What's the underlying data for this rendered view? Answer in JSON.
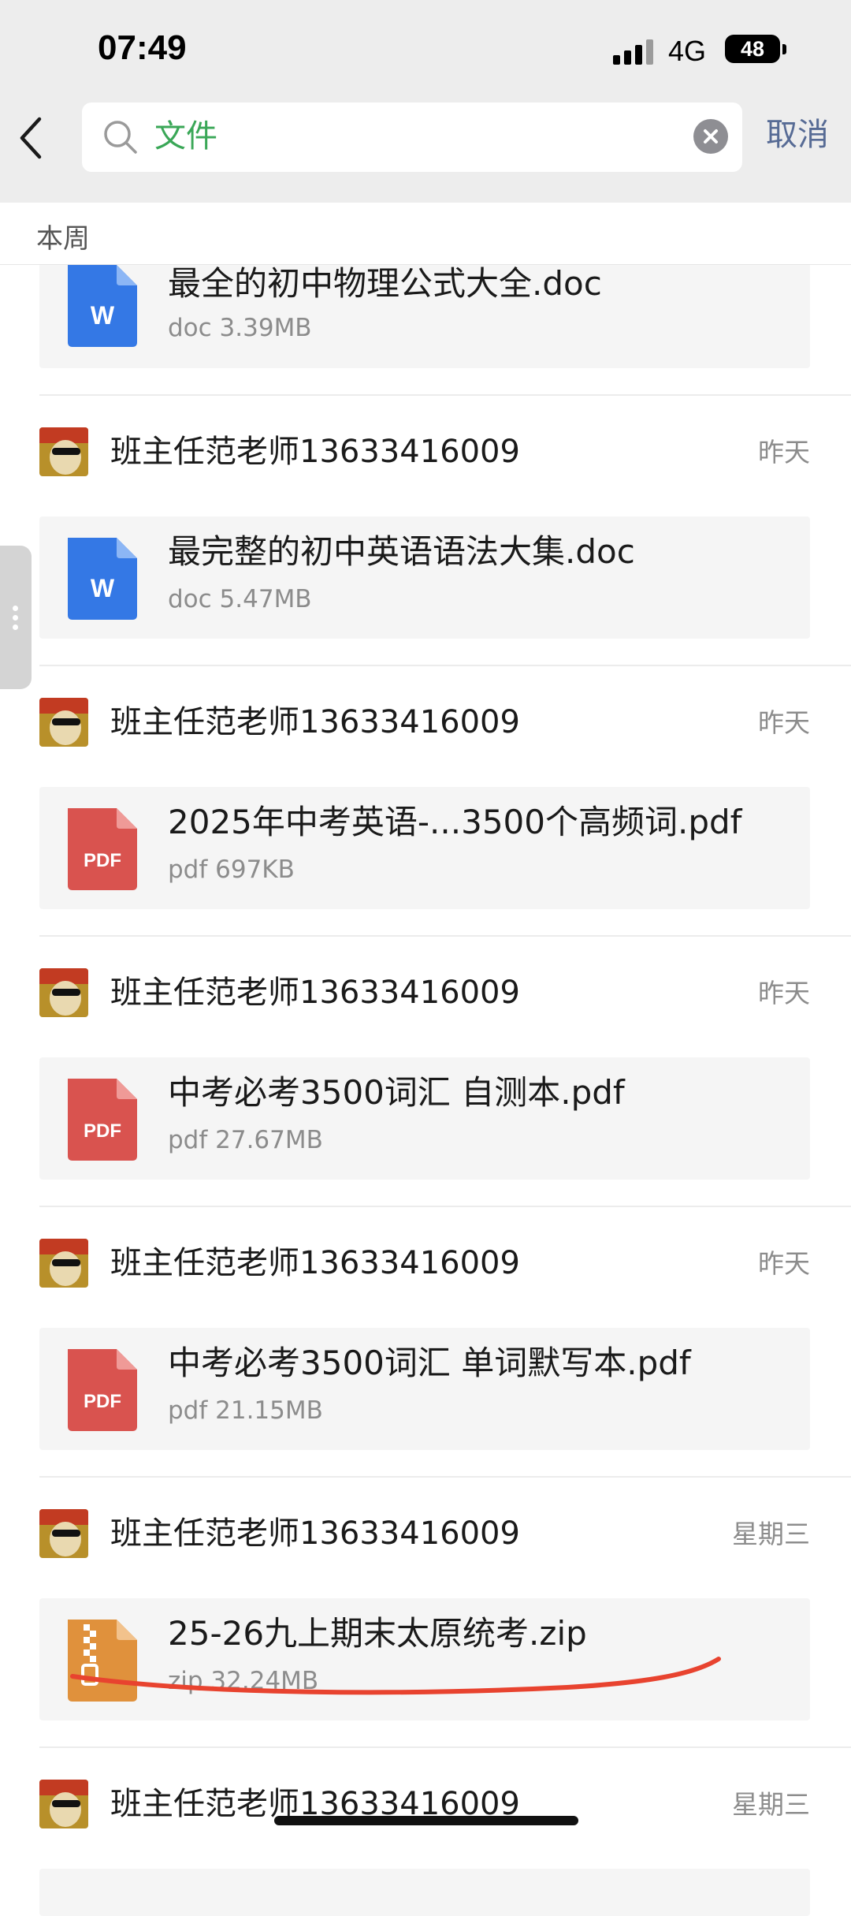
{
  "status_bar": {
    "time": "07:49",
    "network": "4G",
    "battery": "48"
  },
  "search": {
    "query": "文件",
    "cancel_label": "取消"
  },
  "section": {
    "label": "本周"
  },
  "first_file": {
    "name": "最全的初中物理公式大全.doc",
    "meta": "doc 3.39MB",
    "icon": "word-doc-icon"
  },
  "items": [
    {
      "sender": "班主任范老师13633416009",
      "date": "昨天",
      "file_name": "最完整的初中英语语法大集.doc",
      "file_meta": "doc 5.47MB",
      "type": "doc"
    },
    {
      "sender": "班主任范老师13633416009",
      "date": "昨天",
      "file_name": "2025年中考英语-...3500个高频词.pdf",
      "file_meta": "pdf 697KB",
      "type": "pdf"
    },
    {
      "sender": "班主任范老师13633416009",
      "date": "昨天",
      "file_name": "中考必考3500词汇 自测本.pdf",
      "file_meta": "pdf 27.67MB",
      "type": "pdf"
    },
    {
      "sender": "班主任范老师13633416009",
      "date": "昨天",
      "file_name": "中考必考3500词汇 单词默写本.pdf",
      "file_meta": "pdf 21.15MB",
      "type": "pdf"
    },
    {
      "sender": "班主任范老师13633416009",
      "date": "星期三",
      "file_name": "25-26九上期末太原统考.zip",
      "file_meta": "zip 32.24MB",
      "type": "zip"
    }
  ],
  "last_item": {
    "sender": "班主任范老师13633416009",
    "date": "星期三"
  },
  "icon_labels": {
    "word": "W",
    "pdf": "PDF"
  },
  "colors": {
    "word": "#3478e5",
    "pdf": "#d9534f",
    "zip": "#e0913c",
    "search_text": "#3aa757",
    "cancel": "#576b95",
    "annotation": "#e8432f"
  }
}
